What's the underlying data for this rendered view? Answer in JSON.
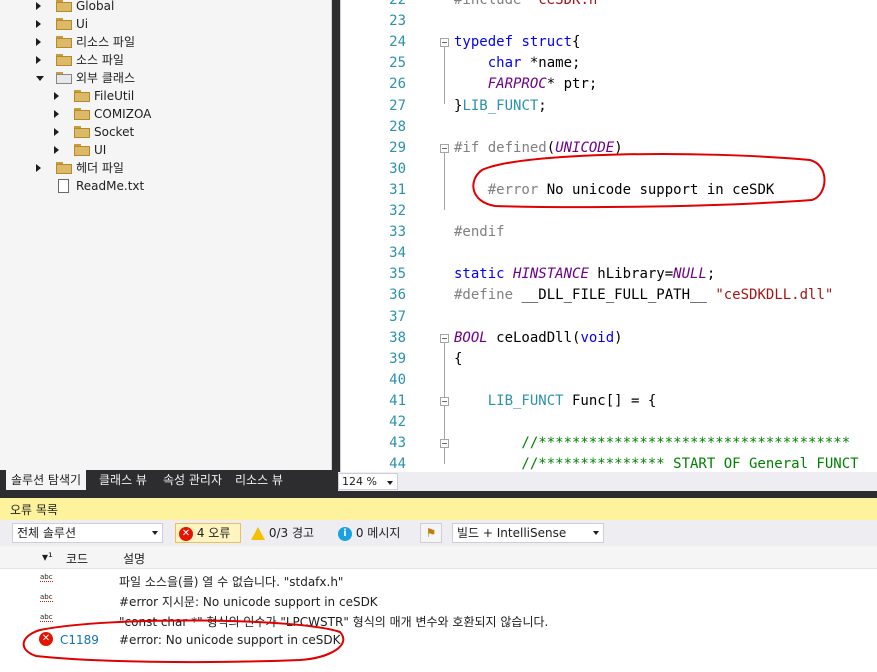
{
  "solution_explorer": {
    "items": [
      {
        "label": "Global",
        "kind": "folder",
        "depth": 0,
        "expander": "collapsed"
      },
      {
        "label": "Ui",
        "kind": "folder",
        "depth": 0,
        "expander": "collapsed"
      },
      {
        "label": "리소스 파일",
        "kind": "folder",
        "depth": 0,
        "expander": "collapsed"
      },
      {
        "label": "소스 파일",
        "kind": "folder",
        "depth": 0,
        "expander": "collapsed"
      },
      {
        "label": "외부 클래스",
        "kind": "external",
        "depth": 0,
        "expander": "expanded"
      },
      {
        "label": "FileUtil",
        "kind": "folder",
        "depth": 1,
        "expander": "collapsed"
      },
      {
        "label": "COMIZOA",
        "kind": "folder",
        "depth": 1,
        "expander": "collapsed"
      },
      {
        "label": "Socket",
        "kind": "folder",
        "depth": 1,
        "expander": "collapsed"
      },
      {
        "label": "UI",
        "kind": "folder",
        "depth": 1,
        "expander": "collapsed"
      },
      {
        "label": "헤더 파일",
        "kind": "folder",
        "depth": 0,
        "expander": "collapsed"
      },
      {
        "label": "ReadMe.txt",
        "kind": "file",
        "depth": 0,
        "expander": "none"
      }
    ],
    "tabs": [
      "솔루션 탐색기",
      "클래스 뷰",
      "속성 관리자",
      "리소스 뷰"
    ]
  },
  "editor": {
    "lines": [
      {
        "n": "22",
        "code": "#include \"ceSDK.h\""
      },
      {
        "n": "23",
        "code": ""
      },
      {
        "n": "24",
        "code": "typedef struct{"
      },
      {
        "n": "25",
        "code": "    char *name;"
      },
      {
        "n": "26",
        "code": "    FARPROC* ptr;"
      },
      {
        "n": "27",
        "code": "}LIB_FUNCT;"
      },
      {
        "n": "28",
        "code": ""
      },
      {
        "n": "29",
        "code": "#if defined(UNICODE)"
      },
      {
        "n": "30",
        "code": ""
      },
      {
        "n": "31",
        "code": "    #error No unicode support in ceSDK"
      },
      {
        "n": "32",
        "code": ""
      },
      {
        "n": "33",
        "code": "#endif"
      },
      {
        "n": "34",
        "code": ""
      },
      {
        "n": "35",
        "code": "static HINSTANCE hLibrary=NULL;"
      },
      {
        "n": "36",
        "code": "#define __DLL_FILE_FULL_PATH__ \"ceSDKDLL.dll\""
      },
      {
        "n": "37",
        "code": ""
      },
      {
        "n": "38",
        "code": "BOOL ceLoadDll(void)"
      },
      {
        "n": "39",
        "code": "{"
      },
      {
        "n": "40",
        "code": ""
      },
      {
        "n": "41",
        "code": "    LIB_FUNCT Func[] = {"
      },
      {
        "n": "42",
        "code": ""
      },
      {
        "n": "43",
        "code": "        //*************************************"
      },
      {
        "n": "44",
        "code": "        //*************** START OF General FUNCT"
      }
    ],
    "zoom": "124 %"
  },
  "error_list": {
    "title": "오류 목록",
    "scope": "전체 솔루션",
    "errors_button": "4 오류",
    "warnings_button": "0/3 경고",
    "messages_button": "0 메시지",
    "source_filter": "빌드 + IntelliSense",
    "columns": {
      "code": "코드",
      "description": "설명"
    },
    "rows": [
      {
        "icon": "abc",
        "code": "",
        "description": "파일 소스을(를) 열 수 없습니다. \"stdafx.h\""
      },
      {
        "icon": "abc",
        "code": "",
        "description": "#error 지시문: No unicode support in ceSDK"
      },
      {
        "icon": "abc",
        "code": "",
        "description": "\"const char *\" 형식의 인수가 \"LPCWSTR\" 형식의 매개 변수와 호환되지 않습니다."
      },
      {
        "icon": "error",
        "code": "C1189",
        "description": "#error:  No unicode support in ceSDK"
      }
    ]
  },
  "colors": {
    "error_title_bg": "#fff29d",
    "annotation": "#e00000",
    "line_numbers": "#2b91af",
    "keyword": "#0000ff"
  }
}
